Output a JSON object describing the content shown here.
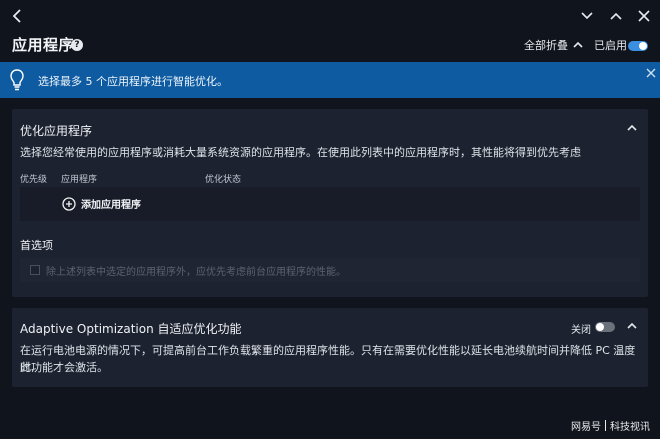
{
  "header": {
    "title": "应用程序",
    "help_glyph": "?",
    "collapse_all_label": "全部折叠",
    "enabled_label": "已启用",
    "enabled": true
  },
  "icons": {
    "back": "chevron-left-icon",
    "minimize": "chevron-down-icon",
    "close": "close-icon",
    "bulb": "lightbulb-icon",
    "add": "plus-circle-icon"
  },
  "banner": {
    "text": "选择最多 5 个应用程序进行智能优化。"
  },
  "optimize_card": {
    "title": "优化应用程序",
    "description": "选择您经常使用的应用程序或消耗大量系统资源的应用程序。在使用此列表中的应用程序时，其性能将得到优先考虑",
    "columns": [
      "优先级",
      "应用程序",
      "优化状态"
    ],
    "add_label": "添加应用程序",
    "preferences_title": "首选项",
    "preference_option": "除上述列表中选定的应用程序外，应优先考虑前台应用程序的性能。",
    "preference_checked": false
  },
  "adaptive_card": {
    "title": "Adaptive Optimization 自适应优化功能",
    "toggle_label": "关闭",
    "toggle_on": false,
    "description_line1": "在运行电池电源的情况下，可提高前台工作负载繁重的应用程序性能。只有在需要优化性能以延长电池续航时间并降低 PC 温度时,",
    "description_line2": "此功能才会激活。"
  },
  "watermark": {
    "source": "网易号",
    "author": "科技视讯"
  },
  "colors": {
    "background": "#10141c",
    "card": "#1c2230",
    "banner": "#0e5ba1",
    "accent": "#3b8fe0"
  }
}
